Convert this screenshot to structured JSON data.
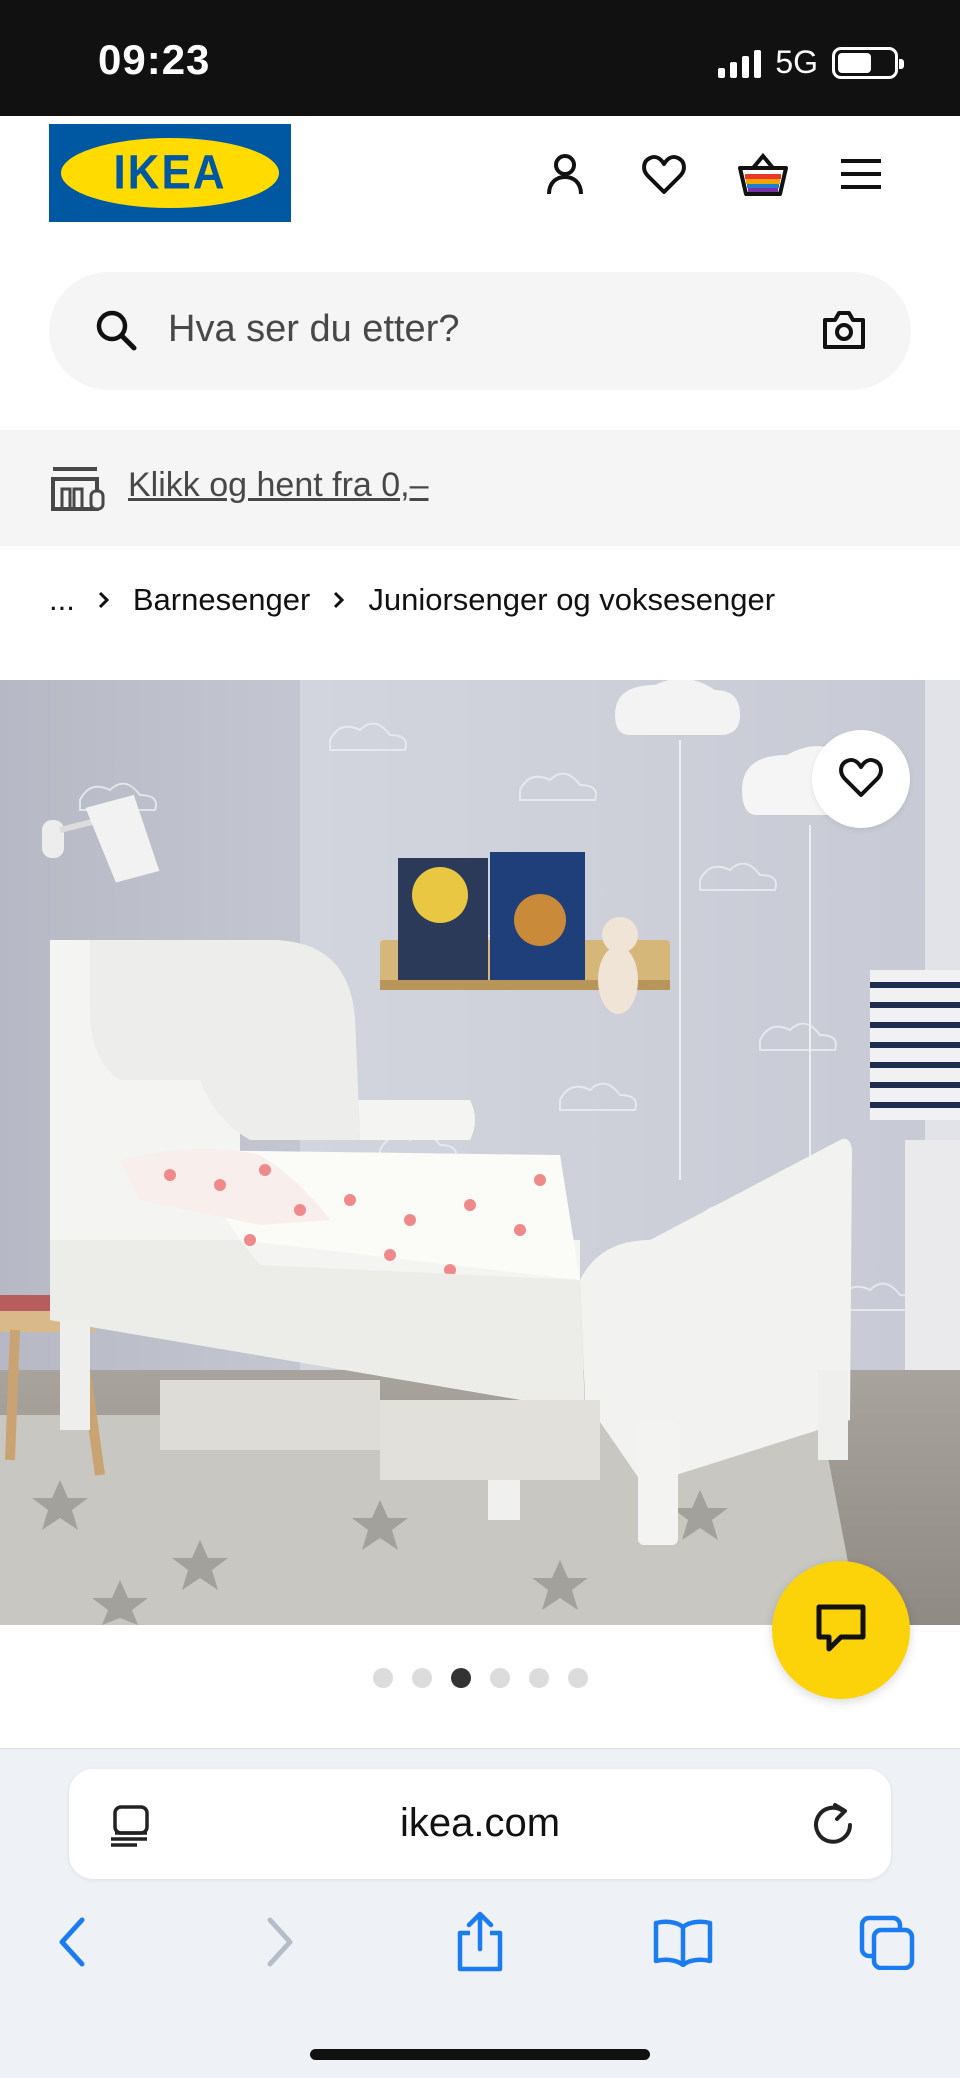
{
  "status_bar": {
    "time": "09:23",
    "network": "5G",
    "battery_level": 0.62,
    "signal_bars": 4
  },
  "header": {
    "logo_text": "IKEA",
    "icons": [
      "account-icon",
      "heart-icon",
      "shopping-bag-icon",
      "menu-icon"
    ]
  },
  "search": {
    "placeholder": "Hva ser du etter?"
  },
  "banner": {
    "link_text": "Klikk og hent fra 0,–"
  },
  "breadcrumb": {
    "items": [
      "...",
      "Barnesenger",
      "Juniorsenger og voksesenger"
    ]
  },
  "gallery": {
    "image_count": 6,
    "active_index": 2
  },
  "browser": {
    "url": "ikea.com"
  },
  "colors": {
    "ikea_blue": "#0058a3",
    "ikea_yellow": "#ffdb00",
    "chat_yellow": "#fcd209",
    "safari_blue": "#1a7cf0"
  }
}
